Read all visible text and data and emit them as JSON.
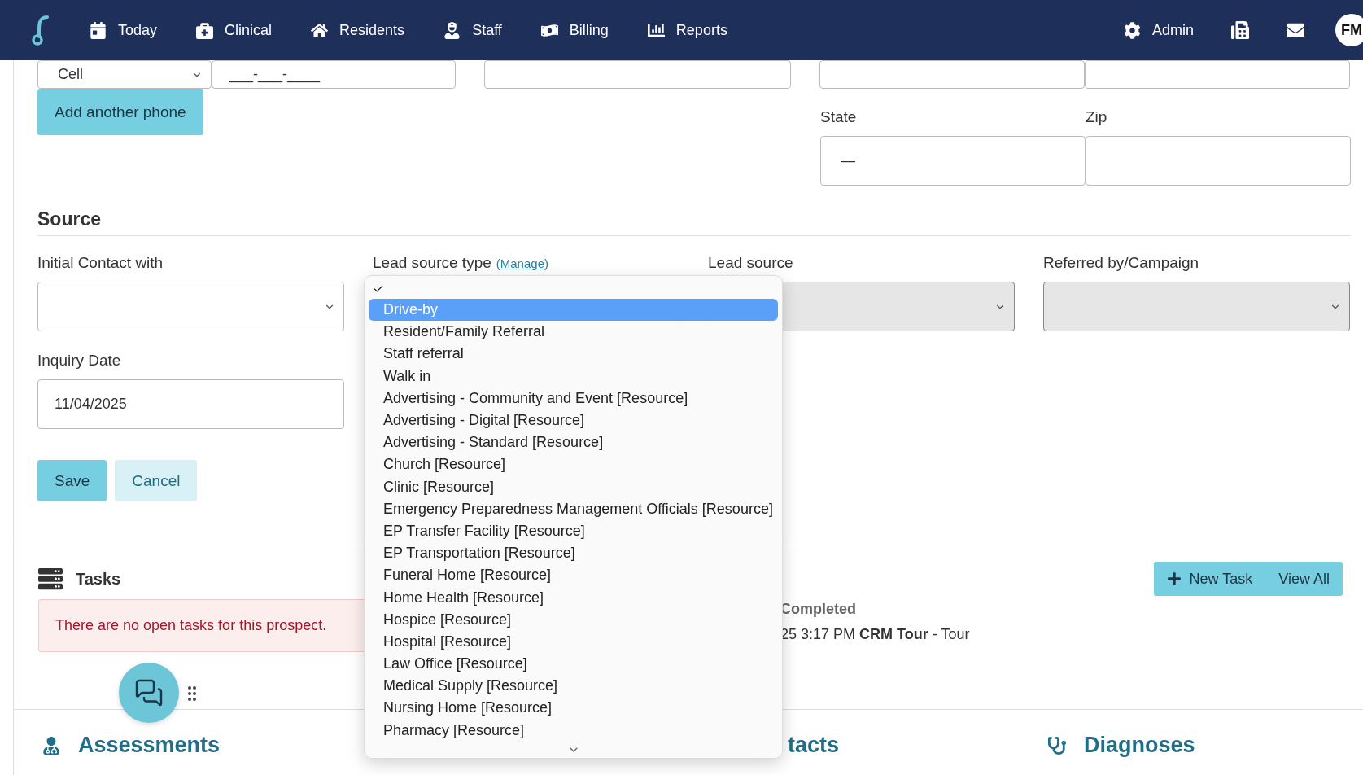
{
  "nav": {
    "items": [
      "Today",
      "Clinical",
      "Residents",
      "Staff",
      "Billing",
      "Reports"
    ],
    "admin": "Admin",
    "avatar": "FM"
  },
  "contact": {
    "phone_type": "Cell",
    "phone_value": "___-___-____",
    "add_phone": "Add another phone",
    "state_label": "State",
    "state_value": "—",
    "zip_label": "Zip"
  },
  "source": {
    "title": "Source",
    "fields": [
      {
        "label": "Initial Contact with",
        "disabled": false
      },
      {
        "label": "Lead source type",
        "link": "Manage",
        "link_open": "(",
        "link_close": ")"
      },
      {
        "label": "Lead source",
        "disabled": true
      },
      {
        "label": "Referred by/Campaign",
        "disabled": true
      }
    ],
    "inquiry": {
      "label": "Inquiry Date",
      "value": "11/04/2025"
    },
    "buttons": [
      {
        "label": "Save",
        "kind": "primary"
      },
      {
        "label": "Cancel",
        "kind": "secondary"
      }
    ]
  },
  "dropdown": {
    "options": [
      {
        "checked": true,
        "selected": false
      },
      {
        "label": "Drive-by",
        "checked": false,
        "selected": true
      },
      {
        "label": "Resident/Family Referral",
        "checked": false,
        "selected": false
      },
      {
        "label": "Staff referral",
        "checked": false,
        "selected": false
      },
      {
        "label": "Walk in",
        "checked": false,
        "selected": false
      },
      {
        "label": "Advertising - Community and Event [Resource]",
        "checked": false,
        "selected": false
      },
      {
        "label": "Advertising - Digital [Resource]",
        "checked": false,
        "selected": false
      },
      {
        "label": "Advertising - Standard [Resource]",
        "checked": false,
        "selected": false
      },
      {
        "label": "Church [Resource]",
        "checked": false,
        "selected": false
      },
      {
        "label": "Clinic [Resource]",
        "checked": false,
        "selected": false
      },
      {
        "label": "Emergency Preparedness Management Officials [Resource]",
        "checked": false,
        "selected": false
      },
      {
        "label": "EP Transfer Facility [Resource]",
        "checked": false,
        "selected": false
      },
      {
        "label": "EP Transportation [Resource]",
        "checked": false,
        "selected": false
      },
      {
        "label": "Funeral Home [Resource]",
        "checked": false,
        "selected": false
      },
      {
        "label": "Home Health [Resource]",
        "checked": false,
        "selected": false
      },
      {
        "label": "Hospice [Resource]",
        "checked": false,
        "selected": false
      },
      {
        "label": "Hospital [Resource]",
        "checked": false,
        "selected": false
      },
      {
        "label": "Law Office [Resource]",
        "checked": false,
        "selected": false
      },
      {
        "label": "Medical Supply [Resource]",
        "checked": false,
        "selected": false
      },
      {
        "label": "Nursing Home [Resource]",
        "checked": false,
        "selected": false
      },
      {
        "label": "Pharmacy [Resource]",
        "checked": false,
        "selected": false
      }
    ]
  },
  "tasks": {
    "title": "Tasks",
    "empty_message": "There are no open tasks for this prospect.",
    "buttons": [
      "New Task",
      "View All"
    ],
    "recent": {
      "heading": "Completed",
      "items": [
        "25 3:17 PM **CRM Tour** - Tour"
      ]
    }
  },
  "sections": [
    {
      "title": "Assessments",
      "kind": "icon"
    },
    {
      "title": "tacts",
      "kind": "plain"
    },
    {
      "title": "Diagnoses",
      "kind": "icon"
    }
  ]
}
